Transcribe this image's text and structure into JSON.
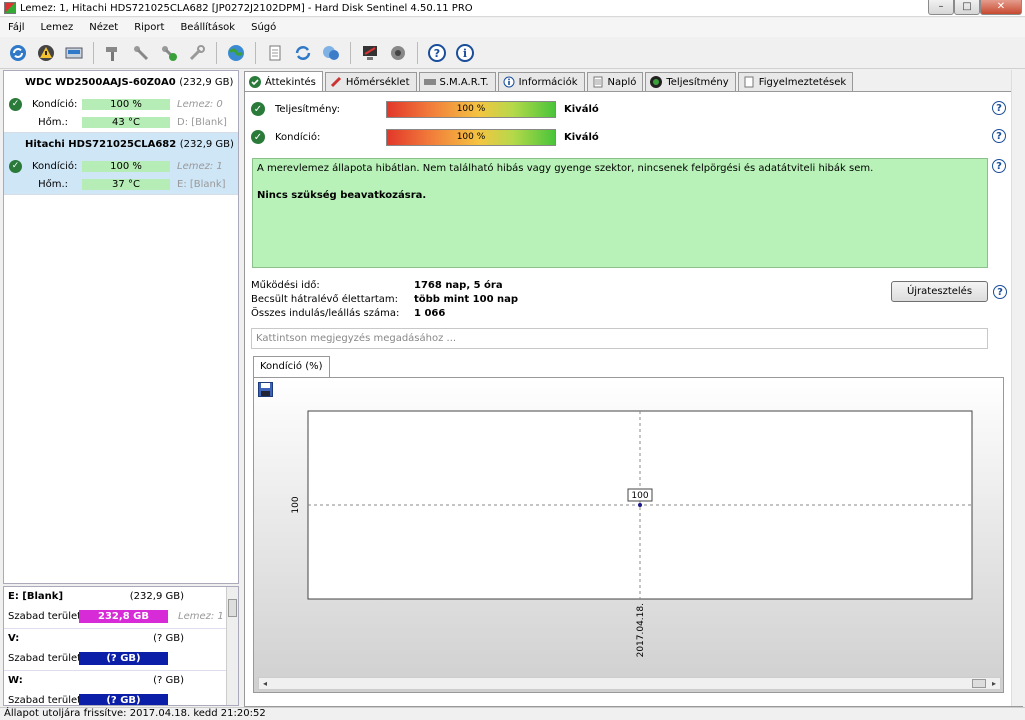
{
  "window": {
    "title": "Lemez: 1, Hitachi HDS721025CLA682 [JP0272J2102DPM]  -  Hard Disk Sentinel 4.50.11 PRO",
    "controls": {
      "minimize": "–",
      "maximize": "□",
      "close": "✕"
    }
  },
  "menu": [
    "Fájl",
    "Lemez",
    "Nézet",
    "Riport",
    "Beállítások",
    "Súgó"
  ],
  "disks": [
    {
      "name": "WDC WD2500AAJS-60Z0A0",
      "size": "(232,9 GB)",
      "condition_label": "Kondíció:",
      "condition_value": "100 %",
      "condition_percent": 100,
      "temp_label": "Hőm.:",
      "temp_value": "43 °C",
      "lemez": "Lemez: 0",
      "volume": "D: [Blank]"
    },
    {
      "name": "Hitachi HDS721025CLA682",
      "size": "(232,9 GB)",
      "condition_label": "Kondíció:",
      "condition_value": "100 %",
      "condition_percent": 100,
      "temp_label": "Hőm.:",
      "temp_value": "37 °C",
      "lemez": "Lemez: 1",
      "volume": "E: [Blank]"
    }
  ],
  "volumes": [
    {
      "name": "E: [Blank]",
      "size": "(232,9 GB)",
      "free_label": "Szabad terület",
      "free_value": "232,8 GB",
      "disk": "Lemez: 1",
      "color": "#d62bd6"
    },
    {
      "name": "V:",
      "size": "(? GB)",
      "free_label": "Szabad terület",
      "free_value": "(? GB)",
      "disk": "",
      "color": "#0a1ea8"
    },
    {
      "name": "W:",
      "size": "(? GB)",
      "free_label": "Szabad terület",
      "free_value": "(? GB)",
      "disk": "",
      "color": "#0a1ea8"
    }
  ],
  "tabs": [
    "Áttekintés",
    "Hőmérséklet",
    "S.M.A.R.T.",
    "Információk",
    "Napló",
    "Teljesítmény",
    "Figyelmeztetések"
  ],
  "overview": {
    "performance": {
      "label": "Teljesítmény:",
      "value": "100 %",
      "rating": "Kiváló"
    },
    "condition": {
      "label": "Kondíció:",
      "value": "100 %",
      "rating": "Kiváló"
    },
    "message": "A merevlemez állapota hibátlan. Nem található hibás vagy gyenge szektor, nincsenek felpörgési és adatátviteli hibák sem.",
    "recommendation": "Nincs szükség beavatkozásra.",
    "stats": [
      {
        "label": "Működési idő:",
        "value": "1768 nap, 5 óra"
      },
      {
        "label": "Becsült hátralévő élettartam:",
        "value": "több mint 100 nap"
      },
      {
        "label": "Összes indulás/leállás száma:",
        "value": "1 066"
      }
    ],
    "retest_button": "Újratesztelés",
    "note_placeholder": "Kattintson megjegyzés megadásához ..."
  },
  "chart_tab": "Kondíció  (%)",
  "chart_data": {
    "type": "line",
    "x": [
      "2017.04.18."
    ],
    "series": [
      {
        "values": [
          100
        ]
      }
    ],
    "ytick_labels": [
      "100"
    ],
    "data_labels": [
      "100"
    ],
    "grid": true
  },
  "status_bar": "Állapot utoljára frissítve: 2017.04.18. kedd 21:20:52"
}
